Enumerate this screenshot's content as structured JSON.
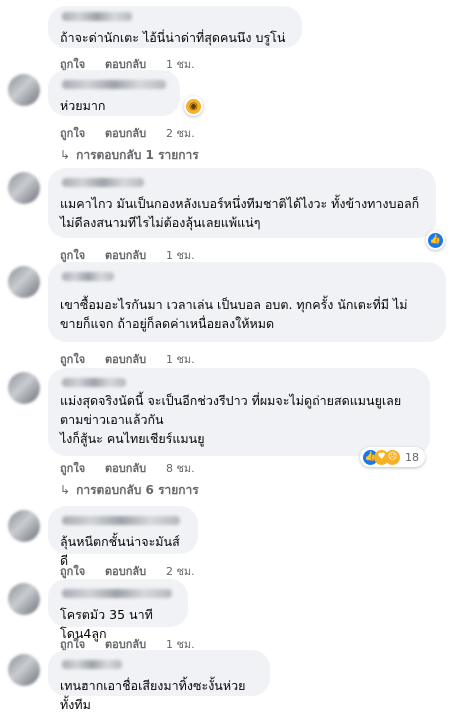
{
  "comments": [
    {
      "text": "ถ้าจะด่านักเตะ ไอ้นี่น่าด่าที่สุดคนนึง บรูโน่",
      "like": "ถูกใจ",
      "reply": "ตอบกลับ",
      "time": "1 ชม."
    },
    {
      "text": "ห่วยมาก",
      "like": "ถูกใจ",
      "reply": "ตอบกลับ",
      "time": "2 ชม.",
      "reaction_icon": "wow-reaction-icon",
      "replies_label": "การตอบกลับ 1 รายการ"
    },
    {
      "text": "แมคาไกว มันเป็นกองหลังเบอร์หนึ่งทีมชาติได้ไงวะ ทั้งข้างทางบอลก็\nไม่ดีลงสนามทีไรไม่ต้องลุ้นเลยแพ้แน่ๆ",
      "like": "ถูกใจ",
      "reply": "ตอบกลับ",
      "time": "1 ชม.",
      "reaction_icon": "like-reaction-icon"
    },
    {
      "text": "เขาซื้อมอะไรกันมา เวลาเล่น เป็นบอล อบต. ทุกครั้ง นักเตะที่มี ไม่\nขายก็แจก ถ้าอยู่ก็ลดค่าเหนื่อยลงให้หมด",
      "like": "ถูกใจ",
      "reply": "ตอบกลับ",
      "time": "1 ชม."
    },
    {
      "text": "แม่งสุดจริงนัดนี้ จะเป็นอีกช่วงรีปาว ที่ผมจะไม่ดูถ่ายสดแมนยูเลย\nตามข่าวเอาแล้วกัน\nไงก็สู้นะ คนไทยเชียร์แมนยู",
      "like": "ถูกใจ",
      "reply": "ตอบกลับ",
      "time": "8 ชม.",
      "reaction_count": "18",
      "replies_label": "การตอบกลับ 6 รายการ"
    },
    {
      "text": "ลุ้นหนีตกชั้นน่าจะมันส์ดี",
      "like": "ถูกใจ",
      "reply": "ตอบกลับ",
      "time": "2 ชม."
    },
    {
      "text": "โครตมัว 35 นาที โดน4ลูก",
      "like": "ถูกใจ",
      "reply": "ตอบกลับ",
      "time": "1 ชม."
    },
    {
      "text": "เทนฮากเอาชื่อเสียงมาทิ้งซะงั้นห่วยทั้งทีม"
    }
  ]
}
